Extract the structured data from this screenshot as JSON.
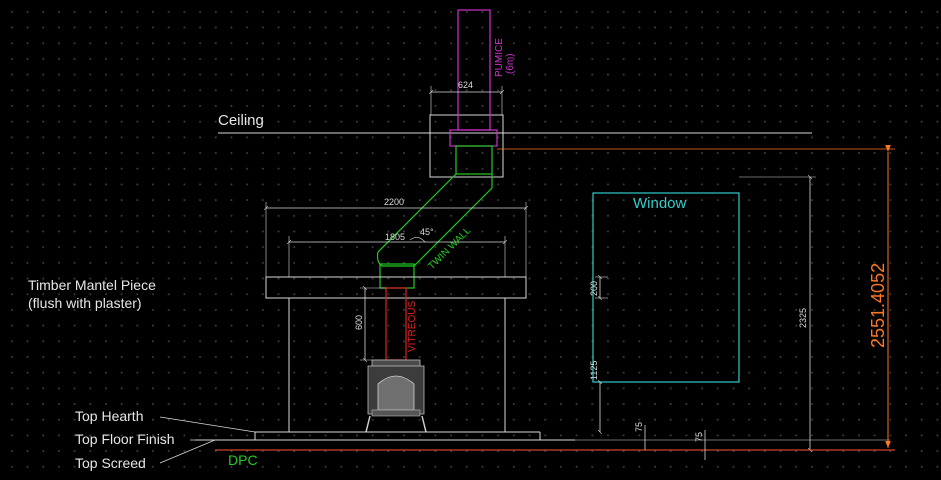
{
  "labels": {
    "ceiling": "Ceiling",
    "window": "Window",
    "mantel_line1": "Timber Mantel Piece",
    "mantel_line2": "(flush with plaster)",
    "top_hearth": "Top Hearth",
    "top_floor_finish": "Top Floor Finish",
    "top_screed": "Top Screed",
    "dpc": "DPC",
    "pumice": "PUMICE",
    "pumice_sub": "(6m)",
    "twin_wall": "TWIN WALL",
    "vitreous": "VITREOUS",
    "angle": "45°"
  },
  "dimensions": {
    "flue_width": "624",
    "outer_width": "2200",
    "inner_width": "1805",
    "vitreous_height": "600",
    "window_head": "200",
    "window_sill": "1125",
    "window_total": "2325",
    "hearth_step": "75",
    "floor_step": "75",
    "floor_to_ceiling": "2551.4052"
  },
  "colors": {
    "background": "#000000",
    "line": "#d9d9d9",
    "pumice": "#cc33cc",
    "twin_wall": "#22cc22",
    "vitreous": "#dd2222",
    "window": "#33cccc",
    "orange_dim": "#ff7722",
    "dpc": "#22cc22"
  }
}
